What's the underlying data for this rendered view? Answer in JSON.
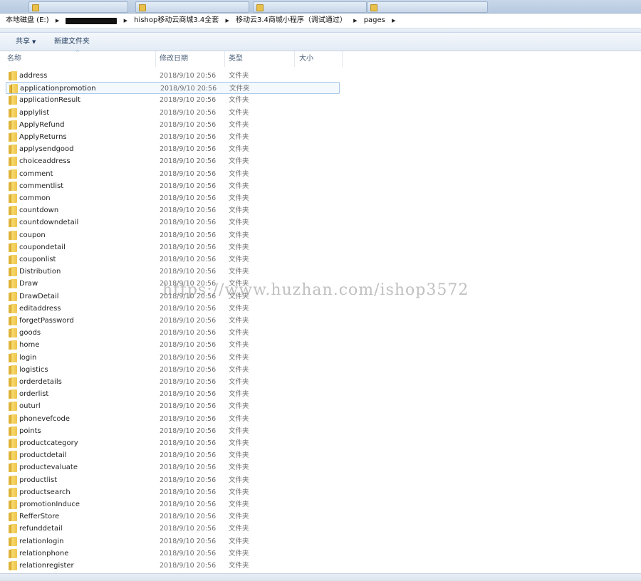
{
  "address_bar": {
    "crumbs": [
      "本地磁盘 (E:)",
      "hishop移动云商城3.4全套",
      "移动云3.4商城小程序（调试通过）",
      "pages"
    ]
  },
  "toolbar": {
    "share_label": "共享",
    "new_folder_label": "新建文件夹"
  },
  "columns": {
    "name": "名称",
    "date": "修改日期",
    "type": "类型",
    "size": "大小"
  },
  "watermark": "https://www.huzhan.com/ishop3572",
  "files": [
    {
      "name": "address",
      "date": "2018/9/10 20:56",
      "type": "文件夹"
    },
    {
      "name": "applicationpromotion",
      "date": "2018/9/10 20:56",
      "type": "文件夹"
    },
    {
      "name": "applicationResult",
      "date": "2018/9/10 20:56",
      "type": "文件夹"
    },
    {
      "name": "applylist",
      "date": "2018/9/10 20:56",
      "type": "文件夹"
    },
    {
      "name": "ApplyRefund",
      "date": "2018/9/10 20:56",
      "type": "文件夹"
    },
    {
      "name": "ApplyReturns",
      "date": "2018/9/10 20:56",
      "type": "文件夹"
    },
    {
      "name": "applysendgood",
      "date": "2018/9/10 20:56",
      "type": "文件夹"
    },
    {
      "name": "choiceaddress",
      "date": "2018/9/10 20:56",
      "type": "文件夹"
    },
    {
      "name": "comment",
      "date": "2018/9/10 20:56",
      "type": "文件夹"
    },
    {
      "name": "commentlist",
      "date": "2018/9/10 20:56",
      "type": "文件夹"
    },
    {
      "name": "common",
      "date": "2018/9/10 20:56",
      "type": "文件夹"
    },
    {
      "name": "countdown",
      "date": "2018/9/10 20:56",
      "type": "文件夹"
    },
    {
      "name": "countdowndetail",
      "date": "2018/9/10 20:56",
      "type": "文件夹"
    },
    {
      "name": "coupon",
      "date": "2018/9/10 20:56",
      "type": "文件夹"
    },
    {
      "name": "coupondetail",
      "date": "2018/9/10 20:56",
      "type": "文件夹"
    },
    {
      "name": "couponlist",
      "date": "2018/9/10 20:56",
      "type": "文件夹"
    },
    {
      "name": "Distribution",
      "date": "2018/9/10 20:56",
      "type": "文件夹"
    },
    {
      "name": "Draw",
      "date": "2018/9/10 20:56",
      "type": "文件夹"
    },
    {
      "name": "DrawDetail",
      "date": "2018/9/10 20:56",
      "type": "文件夹"
    },
    {
      "name": "editaddress",
      "date": "2018/9/10 20:56",
      "type": "文件夹"
    },
    {
      "name": "forgetPassword",
      "date": "2018/9/10 20:56",
      "type": "文件夹"
    },
    {
      "name": "goods",
      "date": "2018/9/10 20:56",
      "type": "文件夹"
    },
    {
      "name": "home",
      "date": "2018/9/10 20:56",
      "type": "文件夹"
    },
    {
      "name": "login",
      "date": "2018/9/10 20:56",
      "type": "文件夹"
    },
    {
      "name": "logistics",
      "date": "2018/9/10 20:56",
      "type": "文件夹"
    },
    {
      "name": "orderdetails",
      "date": "2018/9/10 20:56",
      "type": "文件夹"
    },
    {
      "name": "orderlist",
      "date": "2018/9/10 20:56",
      "type": "文件夹"
    },
    {
      "name": "outurl",
      "date": "2018/9/10 20:56",
      "type": "文件夹"
    },
    {
      "name": "phonevefcode",
      "date": "2018/9/10 20:56",
      "type": "文件夹"
    },
    {
      "name": "points",
      "date": "2018/9/10 20:56",
      "type": "文件夹"
    },
    {
      "name": "productcategory",
      "date": "2018/9/10 20:56",
      "type": "文件夹"
    },
    {
      "name": "productdetail",
      "date": "2018/9/10 20:56",
      "type": "文件夹"
    },
    {
      "name": "productevaluate",
      "date": "2018/9/10 20:56",
      "type": "文件夹"
    },
    {
      "name": "productlist",
      "date": "2018/9/10 20:56",
      "type": "文件夹"
    },
    {
      "name": "productsearch",
      "date": "2018/9/10 20:56",
      "type": "文件夹"
    },
    {
      "name": "promotionInduce",
      "date": "2018/9/10 20:56",
      "type": "文件夹"
    },
    {
      "name": "RefferStore",
      "date": "2018/9/10 20:56",
      "type": "文件夹"
    },
    {
      "name": "refunddetail",
      "date": "2018/9/10 20:56",
      "type": "文件夹"
    },
    {
      "name": "relationlogin",
      "date": "2018/9/10 20:56",
      "type": "文件夹"
    },
    {
      "name": "relationphone",
      "date": "2018/9/10 20:56",
      "type": "文件夹"
    },
    {
      "name": "relationregister",
      "date": "2018/9/10 20:56",
      "type": "文件夹"
    }
  ]
}
